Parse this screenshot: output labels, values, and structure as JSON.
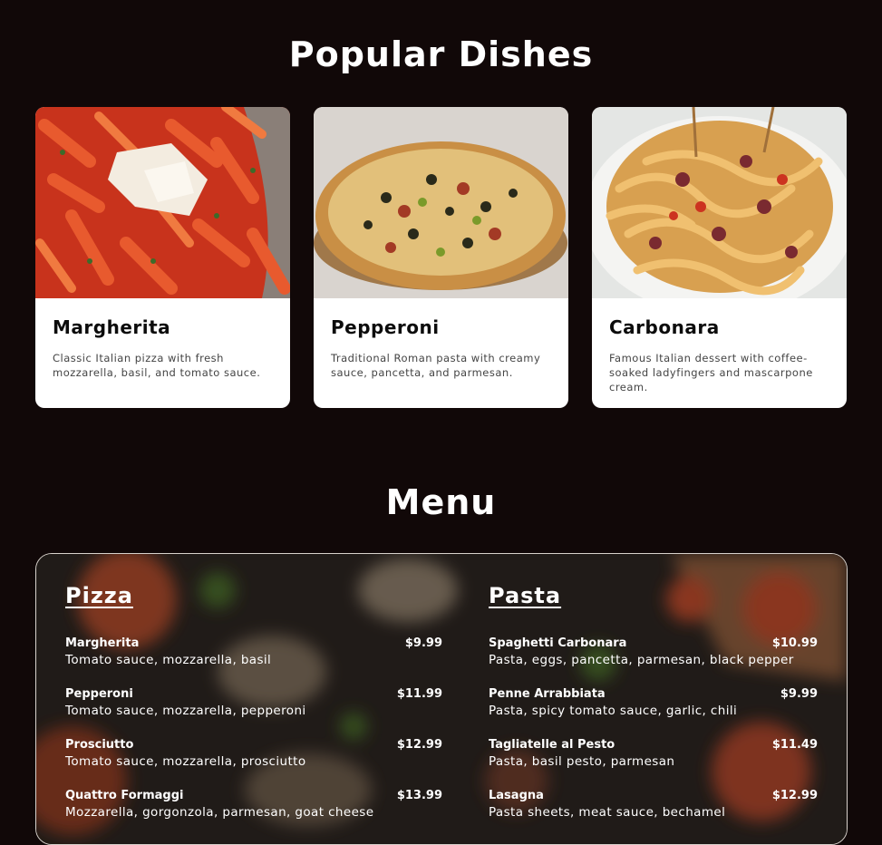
{
  "popular": {
    "title": "Popular Dishes",
    "cards": [
      {
        "name": "Margherita",
        "description": "Classic Italian pizza with fresh mozzarella, basil, and tomato sauce.",
        "image": "penne-pasta-image"
      },
      {
        "name": "Pepperoni",
        "description": "Traditional Roman pasta with creamy sauce, pancetta, and parmesan.",
        "image": "pizza-image"
      },
      {
        "name": "Carbonara",
        "description": "Famous Italian dessert with coffee-soaked ladyfingers and mascarpone cream.",
        "image": "tagliatelle-pasta-image"
      }
    ]
  },
  "menu": {
    "title": "Menu",
    "categories": [
      {
        "title": "Pizza",
        "items": [
          {
            "name": "Margherita",
            "price": "$9.99",
            "description": "Tomato sauce, mozzarella, basil"
          },
          {
            "name": "Pepperoni",
            "price": "$11.99",
            "description": "Tomato sauce, mozzarella, pepperoni"
          },
          {
            "name": "Prosciutto",
            "price": "$12.99",
            "description": "Tomato sauce, mozzarella, prosciutto"
          },
          {
            "name": "Quattro Formaggi",
            "price": "$13.99",
            "description": "Mozzarella, gorgonzola, parmesan, goat cheese"
          }
        ]
      },
      {
        "title": "Pasta",
        "items": [
          {
            "name": "Spaghetti Carbonara",
            "price": "$10.99",
            "description": "Pasta, eggs, pancetta, parmesan, black pepper"
          },
          {
            "name": "Penne Arrabbiata",
            "price": "$9.99",
            "description": "Pasta, spicy tomato sauce, garlic, chili"
          },
          {
            "name": "Tagliatelle al Pesto",
            "price": "$11.49",
            "description": "Pasta, basil pesto, parmesan"
          },
          {
            "name": "Lasagna",
            "price": "$12.99",
            "description": "Pasta sheets, meat sauce, bechamel"
          }
        ]
      }
    ]
  }
}
